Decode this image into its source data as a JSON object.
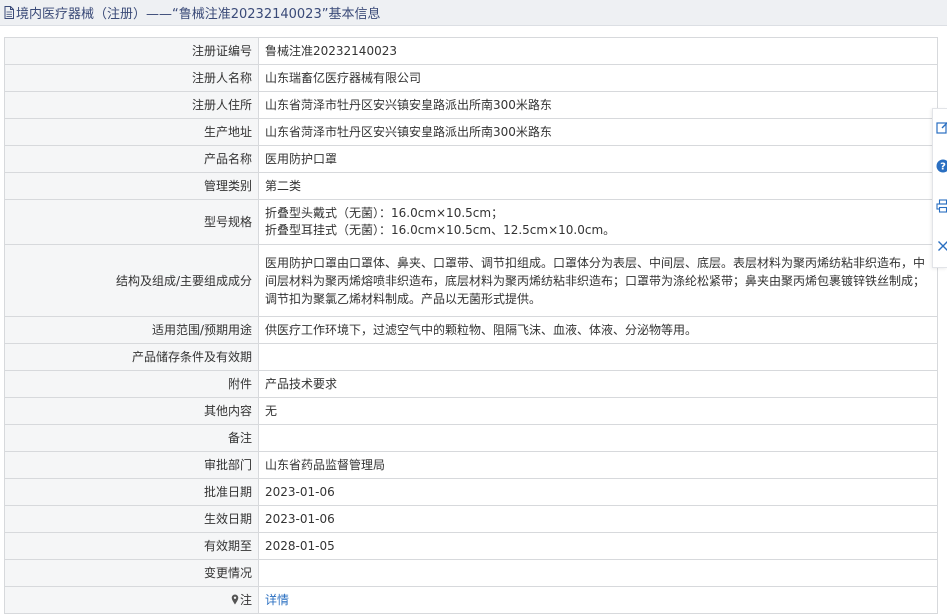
{
  "header": {
    "title": "境内医疗器械（注册）——“鲁械注准20232140023”基本信息"
  },
  "rows": [
    {
      "label": "注册证编号",
      "value": "鲁械注准20232140023"
    },
    {
      "label": "注册人名称",
      "value": "山东瑞畜亿医疗器械有限公司"
    },
    {
      "label": "注册人住所",
      "value": "山东省菏泽市牡丹区安兴镇安皇路派出所南300米路东"
    },
    {
      "label": "生产地址",
      "value": "山东省菏泽市牡丹区安兴镇安皇路派出所南300米路东"
    },
    {
      "label": "产品名称",
      "value": "医用防护口罩"
    },
    {
      "label": "管理类别",
      "value": "第二类"
    },
    {
      "label": "型号规格",
      "lines": [
        "折叠型头戴式（无菌）：16.0cm×10.5cm；",
        "折叠型耳挂式（无菌）：16.0cm×10.5cm、12.5cm×10.0cm。"
      ]
    },
    {
      "label": "结构及组成/主要组成成分",
      "value": "医用防护口罩由口罩体、鼻夹、口罩带、调节扣组成。口罩体分为表层、中间层、底层。表层材料为聚丙烯纺粘非织造布，中间层材料为聚丙烯熔喷非织造布，底层材料为聚丙烯纺粘非织造布；口罩带为涤纶松紧带；鼻夹由聚丙烯包裹镀锌铁丝制成；调节扣为聚氯乙烯材料制成。产品以无菌形式提供。"
    },
    {
      "label": "适用范围/预期用途",
      "value": "供医疗工作环境下，过滤空气中的颗粒物、阻隔飞沫、血液、体液、分泌物等用。"
    },
    {
      "label": "产品储存条件及有效期",
      "value": ""
    },
    {
      "label": "附件",
      "value": "产品技术要求"
    },
    {
      "label": "其他内容",
      "value": "无"
    },
    {
      "label": "备注",
      "value": ""
    },
    {
      "label": "审批部门",
      "value": "山东省药品监督管理局"
    },
    {
      "label": "批准日期",
      "value": "2023-01-06"
    },
    {
      "label": "生效日期",
      "value": "2023-01-06"
    },
    {
      "label": "有效期至",
      "value": "2028-01-05"
    },
    {
      "label": "变更情况",
      "value": ""
    },
    {
      "label": "注",
      "value": "详情"
    }
  ],
  "icons": {
    "header": "document-icon",
    "note": "pin-icon",
    "side_tools": [
      "edit-icon",
      "help-icon",
      "print-icon",
      "close-icon"
    ]
  },
  "colors": {
    "link": "#2a6fc1",
    "label_bg": "#f5f6f7",
    "header_bg": "#eef0f3",
    "border": "#d7d9dc"
  }
}
